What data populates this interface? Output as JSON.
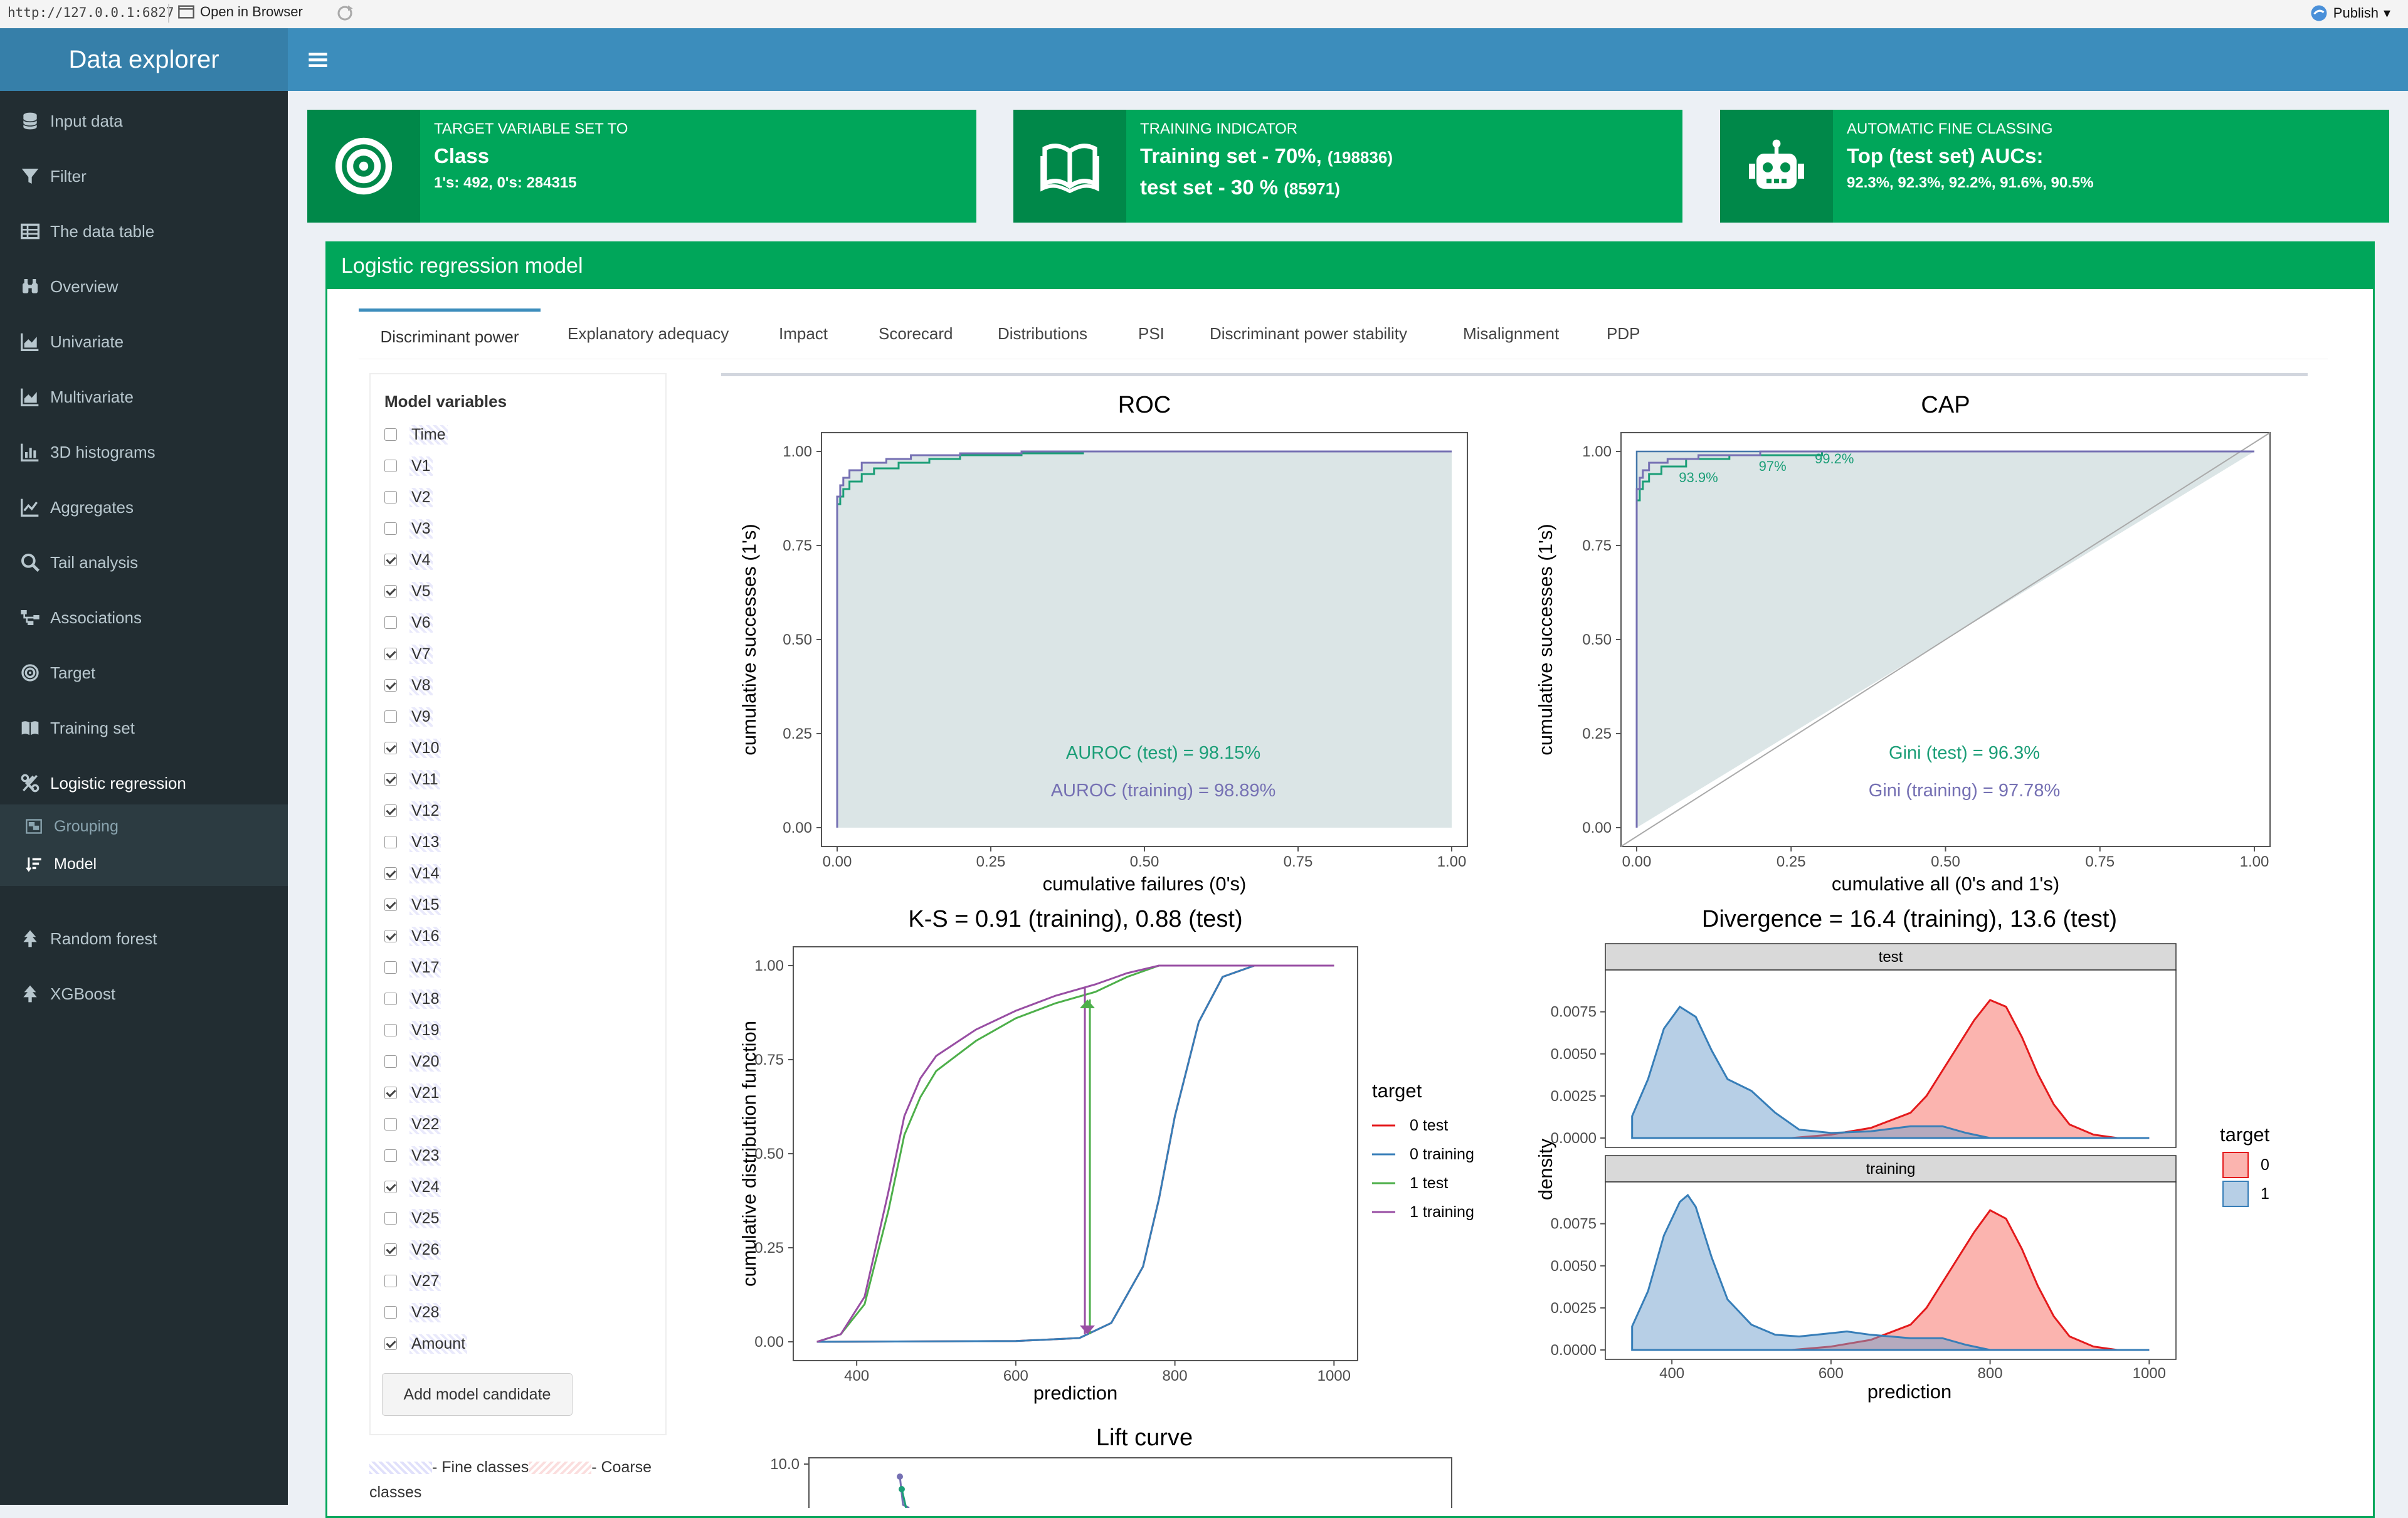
{
  "browser": {
    "url": "http://127.0.0.1:6827",
    "open_label": "Open in Browser",
    "publish_label": "Publish"
  },
  "app": {
    "title": "Data explorer"
  },
  "sidebar": {
    "items": [
      {
        "label": "Input data",
        "icon": "database-icon"
      },
      {
        "label": "Filter",
        "icon": "filter-icon"
      },
      {
        "label": "The data table",
        "icon": "table-icon"
      },
      {
        "label": "Overview",
        "icon": "binoculars-icon"
      },
      {
        "label": "Univariate",
        "icon": "area-chart-icon"
      },
      {
        "label": "Multivariate",
        "icon": "area-chart-icon"
      },
      {
        "label": "3D histograms",
        "icon": "bar-chart-icon"
      },
      {
        "label": "Aggregates",
        "icon": "line-chart-icon"
      },
      {
        "label": "Tail analysis",
        "icon": "search-icon"
      },
      {
        "label": "Associations",
        "icon": "sitemap-icon"
      },
      {
        "label": "Target",
        "icon": "bullseye-icon"
      },
      {
        "label": "Training set",
        "icon": "book-icon"
      },
      {
        "label": "Logistic regression",
        "icon": "percent-icon"
      }
    ],
    "sub_items": [
      {
        "label": "Grouping",
        "icon": "object-group-icon"
      },
      {
        "label": "Model",
        "icon": "sort-amount-icon"
      }
    ],
    "items_after": [
      {
        "label": "Random forest",
        "icon": "tree-icon"
      },
      {
        "label": "XGBoost",
        "icon": "tree-icon"
      }
    ]
  },
  "info_boxes": [
    {
      "line1": "TARGET VARIABLE SET TO",
      "line2": "Class",
      "line2_small": "",
      "line3": "1's: 492, 0's: 284315",
      "line3_small": "",
      "icon": "bullseye-icon"
    },
    {
      "line1": "TRAINING INDICATOR",
      "line2": "Training set - 70%,",
      "line2_small": "(198836)",
      "line3": "test set - 30 %",
      "line3_small": "(85971)",
      "icon": "book-open-icon"
    },
    {
      "line1": "AUTOMATIC FINE CLASSING",
      "line2": "Top (test set) AUCs:",
      "line2_small": "",
      "line3": "92.3%, 92.3%, 92.2%, 91.6%, 90.5%",
      "line3_small": "",
      "icon": "robot-icon"
    }
  ],
  "panel": {
    "title": "Logistic regression model"
  },
  "tabs": [
    "Discriminant power",
    "Explanatory adequacy",
    "Impact",
    "Scorecard",
    "Distributions",
    "PSI",
    "Discriminant power stability",
    "Misalignment",
    "PDP"
  ],
  "active_tab": 0,
  "model_variables": {
    "title": "Model variables",
    "items": [
      {
        "name": "Time",
        "checked": false
      },
      {
        "name": "V1",
        "checked": false
      },
      {
        "name": "V2",
        "checked": false
      },
      {
        "name": "V3",
        "checked": false
      },
      {
        "name": "V4",
        "checked": true
      },
      {
        "name": "V5",
        "checked": true
      },
      {
        "name": "V6",
        "checked": false
      },
      {
        "name": "V7",
        "checked": true
      },
      {
        "name": "V8",
        "checked": true
      },
      {
        "name": "V9",
        "checked": false
      },
      {
        "name": "V10",
        "checked": true
      },
      {
        "name": "V11",
        "checked": true
      },
      {
        "name": "V12",
        "checked": true
      },
      {
        "name": "V13",
        "checked": false
      },
      {
        "name": "V14",
        "checked": true
      },
      {
        "name": "V15",
        "checked": true
      },
      {
        "name": "V16",
        "checked": true
      },
      {
        "name": "V17",
        "checked": false
      },
      {
        "name": "V18",
        "checked": false
      },
      {
        "name": "V19",
        "checked": false
      },
      {
        "name": "V20",
        "checked": false
      },
      {
        "name": "V21",
        "checked": true
      },
      {
        "name": "V22",
        "checked": false
      },
      {
        "name": "V23",
        "checked": false
      },
      {
        "name": "V24",
        "checked": true
      },
      {
        "name": "V25",
        "checked": false
      },
      {
        "name": "V26",
        "checked": true
      },
      {
        "name": "V27",
        "checked": false
      },
      {
        "name": "V28",
        "checked": false
      },
      {
        "name": "Amount",
        "checked": true
      }
    ],
    "add_button": "Add model candidate",
    "legend_fine": "- Fine classes",
    "legend_coarse": "- Coarse classes"
  },
  "colors": {
    "header": "#3c8dbc",
    "logo": "#367fa9",
    "sidebar": "#222d32",
    "green": "#00a65a",
    "test_green": "#1a9850",
    "training_purple": "#7570b3",
    "red": "#e41a1c",
    "blue": "#377eb8"
  },
  "chart_data": [
    {
      "type": "line",
      "title": "ROC",
      "xlabel": "cumulative failures (0's)",
      "ylabel": "cumulative successes (1's)",
      "xlim": [
        0,
        1
      ],
      "ylim": [
        0,
        1
      ],
      "x_ticks": [
        "0.00",
        "0.25",
        "0.50",
        "0.75",
        "1.00"
      ],
      "y_ticks": [
        "0.00",
        "0.25",
        "0.50",
        "0.75",
        "1.00"
      ],
      "annotations": [
        "AUROC (test) = 98.15%",
        "AUROC (training) = 98.89%"
      ],
      "series": [
        {
          "name": "test",
          "x": [
            0,
            0,
            0.005,
            0.01,
            0.02,
            0.04,
            0.06,
            0.1,
            0.15,
            0.2,
            0.3,
            0.4,
            0.6,
            1
          ],
          "y": [
            0,
            0.82,
            0.86,
            0.88,
            0.9,
            0.92,
            0.94,
            0.955,
            0.97,
            0.98,
            0.99,
            0.995,
            1,
            1
          ]
        },
        {
          "name": "training",
          "x": [
            0,
            0,
            0.005,
            0.01,
            0.02,
            0.04,
            0.08,
            0.12,
            0.2,
            0.3,
            0.5,
            1
          ],
          "y": [
            0,
            0.84,
            0.88,
            0.91,
            0.93,
            0.95,
            0.97,
            0.98,
            0.99,
            0.995,
            1,
            1
          ]
        }
      ]
    },
    {
      "type": "line",
      "title": "CAP",
      "xlabel": "cumulative all (0's and 1's)",
      "ylabel": "cumulative successes (1's)",
      "xlim": [
        0,
        1
      ],
      "ylim": [
        0,
        1
      ],
      "x_ticks": [
        "0.00",
        "0.25",
        "0.50",
        "0.75",
        "1.00"
      ],
      "y_ticks": [
        "0.00",
        "0.25",
        "0.50",
        "0.75",
        "1.00"
      ],
      "annotations": [
        "Gini (test) = 96.3%",
        "Gini (training) = 97.78%"
      ],
      "point_labels": [
        "93.9%",
        "97%",
        "99.2%"
      ],
      "series": [
        {
          "name": "test",
          "x": [
            0,
            0,
            0.005,
            0.01,
            0.02,
            0.04,
            0.08,
            0.15,
            0.3,
            0.6,
            1
          ],
          "y": [
            0,
            0.82,
            0.87,
            0.9,
            0.92,
            0.94,
            0.96,
            0.98,
            0.99,
            1,
            1
          ]
        },
        {
          "name": "training",
          "x": [
            0,
            0,
            0.005,
            0.01,
            0.02,
            0.05,
            0.1,
            0.2,
            0.35,
            1
          ],
          "y": [
            0,
            0.85,
            0.9,
            0.93,
            0.95,
            0.97,
            0.98,
            0.99,
            1,
            1
          ]
        }
      ]
    },
    {
      "type": "line",
      "title": "K-S = 0.91 (training), 0.88 (test)",
      "xlabel": "prediction",
      "ylabel": "cumulative distribution function",
      "xlim": [
        340,
        1010
      ],
      "ylim": [
        0,
        1
      ],
      "x_ticks": [
        "400",
        "600",
        "800",
        "1000"
      ],
      "y_ticks": [
        "0.00",
        "0.25",
        "0.50",
        "0.75",
        "1.00"
      ],
      "legend_title": "target",
      "series": [
        {
          "name": "0 test",
          "x": [
            350,
            600,
            680,
            720,
            760,
            780,
            800,
            830,
            860,
            900,
            1000
          ],
          "y": [
            0,
            0.002,
            0.01,
            0.05,
            0.2,
            0.38,
            0.6,
            0.85,
            0.97,
            1,
            1
          ]
        },
        {
          "name": "0 training",
          "x": [
            350,
            600,
            680,
            720,
            760,
            780,
            800,
            830,
            860,
            900,
            1000
          ],
          "y": [
            0,
            0.002,
            0.01,
            0.05,
            0.2,
            0.38,
            0.6,
            0.85,
            0.97,
            1,
            1
          ]
        },
        {
          "name": "1 test",
          "x": [
            350,
            380,
            410,
            440,
            460,
            480,
            500,
            550,
            600,
            650,
            700,
            740,
            780,
            1000
          ],
          "y": [
            0,
            0.02,
            0.1,
            0.35,
            0.55,
            0.65,
            0.72,
            0.8,
            0.86,
            0.9,
            0.93,
            0.97,
            1,
            1
          ]
        },
        {
          "name": "1 training",
          "x": [
            350,
            380,
            410,
            440,
            460,
            480,
            500,
            550,
            600,
            650,
            700,
            740,
            780,
            1000
          ],
          "y": [
            0,
            0.02,
            0.12,
            0.4,
            0.6,
            0.7,
            0.76,
            0.83,
            0.88,
            0.92,
            0.95,
            0.98,
            1,
            1
          ]
        }
      ]
    },
    {
      "type": "area",
      "title": "Divergence = 16.4 (training), 13.6 (test)",
      "xlabel": "prediction",
      "ylabel": "density",
      "xlim": [
        340,
        1010
      ],
      "ylim": [
        0,
        0.0095
      ],
      "x_ticks": [
        "400",
        "600",
        "800",
        "1000"
      ],
      "y_ticks": [
        "0.0000",
        "0.0025",
        "0.0050",
        "0.0075"
      ],
      "legend_title": "target",
      "legend": [
        "0",
        "1"
      ],
      "facets": [
        {
          "name": "test",
          "series": [
            {
              "name": "0",
              "x": [
                350,
                550,
                600,
                650,
                700,
                720,
                740,
                760,
                780,
                800,
                820,
                840,
                860,
                880,
                900,
                930,
                960,
                1000
              ],
              "y": [
                0,
                0,
                0.0002,
                0.0006,
                0.0015,
                0.0025,
                0.004,
                0.0055,
                0.007,
                0.0082,
                0.0078,
                0.006,
                0.0038,
                0.002,
                0.0008,
                0.0002,
                0,
                0
              ]
            },
            {
              "name": "1",
              "x": [
                350,
                370,
                390,
                410,
                430,
                450,
                470,
                500,
                530,
                560,
                600,
                650,
                700,
                740,
                770,
                800,
                1000
              ],
              "y": [
                0.0013,
                0.0035,
                0.0065,
                0.0078,
                0.0072,
                0.0052,
                0.0035,
                0.0028,
                0.0015,
                0.0005,
                0.0003,
                0.0004,
                0.0007,
                0.0007,
                0.0003,
                0,
                0
              ]
            }
          ]
        },
        {
          "name": "training",
          "series": [
            {
              "name": "0",
              "x": [
                350,
                550,
                600,
                650,
                700,
                720,
                740,
                760,
                780,
                800,
                820,
                840,
                860,
                880,
                900,
                930,
                960,
                1000
              ],
              "y": [
                0,
                0,
                0.0002,
                0.0006,
                0.0015,
                0.0025,
                0.004,
                0.0055,
                0.007,
                0.0083,
                0.0078,
                0.006,
                0.0038,
                0.002,
                0.0008,
                0.0002,
                0,
                0
              ]
            },
            {
              "name": "1",
              "x": [
                350,
                370,
                390,
                410,
                420,
                430,
                450,
                470,
                500,
                530,
                560,
                600,
                620,
                650,
                700,
                740,
                770,
                800,
                1000
              ],
              "y": [
                0.0014,
                0.0035,
                0.0068,
                0.0088,
                0.0092,
                0.0085,
                0.0055,
                0.003,
                0.0015,
                0.0009,
                0.0008,
                0.001,
                0.0011,
                0.0009,
                0.0007,
                0.0007,
                0.0003,
                0,
                0
              ]
            }
          ]
        }
      ]
    },
    {
      "type": "line",
      "title": "Lift curve",
      "ylim": [
        0,
        10
      ],
      "y_ticks": [
        "10.0"
      ],
      "series": [
        {
          "name": "test",
          "x": [
            0
          ],
          "y": [
            10
          ]
        }
      ]
    }
  ]
}
